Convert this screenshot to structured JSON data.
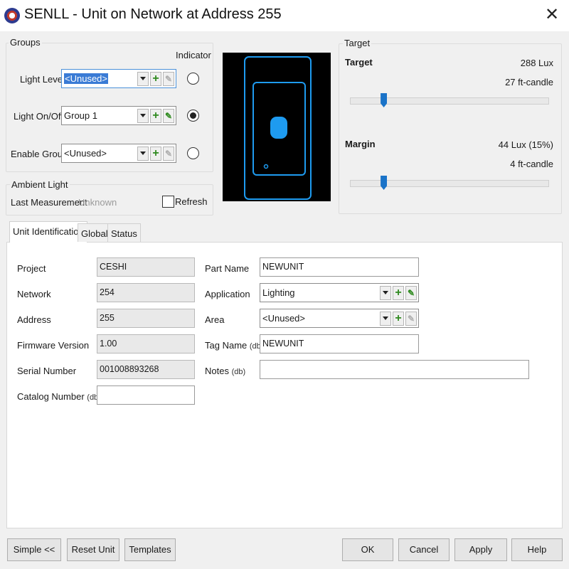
{
  "window": {
    "title": "SENLL - Unit on Network at Address 255",
    "close_glyph": "✕",
    "app_icon": "senll-app-icon"
  },
  "groups": {
    "title": "Groups",
    "indicator_label": "Indicator",
    "rows": [
      {
        "label": "Light Level",
        "value": "<Unused>",
        "selected_text": true,
        "pencil_enabled": false,
        "indicator_selected": false
      },
      {
        "label": "Light On/Off",
        "value": "Group 1",
        "selected_text": false,
        "pencil_enabled": true,
        "indicator_selected": true
      },
      {
        "label": "Enable Group",
        "value": "<Unused>",
        "selected_text": false,
        "pencil_enabled": false,
        "indicator_selected": false
      }
    ]
  },
  "ambient": {
    "title": "Ambient Light",
    "last_measurement_label": "Last Measurement",
    "last_measurement_value": "Unknown",
    "refresh_label": "Refresh"
  },
  "target": {
    "title": "Target",
    "target_label": "Target",
    "target_lux": "288 Lux",
    "target_fc": "27 ft-candle",
    "target_slider_fraction": 0.17,
    "margin_label": "Margin",
    "margin_lux": "44 Lux (15%)",
    "margin_fc": "4 ft-candle",
    "margin_slider_fraction": 0.17
  },
  "preview": {
    "background": "#000000",
    "accent": "#1e9bf0"
  },
  "tabs": [
    {
      "label": "Unit Identification",
      "active": true
    },
    {
      "label": "Global",
      "active": false
    },
    {
      "label": "Status",
      "active": false
    }
  ],
  "unit_identification": {
    "project_label": "Project",
    "project_value": "CESHI",
    "network_label": "Network",
    "network_value": "254",
    "address_label": "Address",
    "address_value": "255",
    "firmware_label": "Firmware Version",
    "firmware_value": "1.00",
    "serial_label": "Serial Number",
    "serial_value": "001008893268",
    "catalog_label": "Catalog Number",
    "catalog_value": "",
    "part_name_label": "Part Name",
    "part_name_value": "NEWUNIT",
    "application_label": "Application",
    "application_value": "Lighting",
    "area_label": "Area",
    "area_value": "<Unused>",
    "tag_name_label": "Tag Name",
    "tag_name_value": "NEWUNIT",
    "notes_label": "Notes",
    "notes_value": "",
    "db_tag": "(db)"
  },
  "buttons": {
    "simple": "Simple <<",
    "reset_unit": "Reset Unit",
    "templates": "Templates",
    "ok": "OK",
    "cancel": "Cancel",
    "apply": "Apply",
    "help": "Help"
  }
}
